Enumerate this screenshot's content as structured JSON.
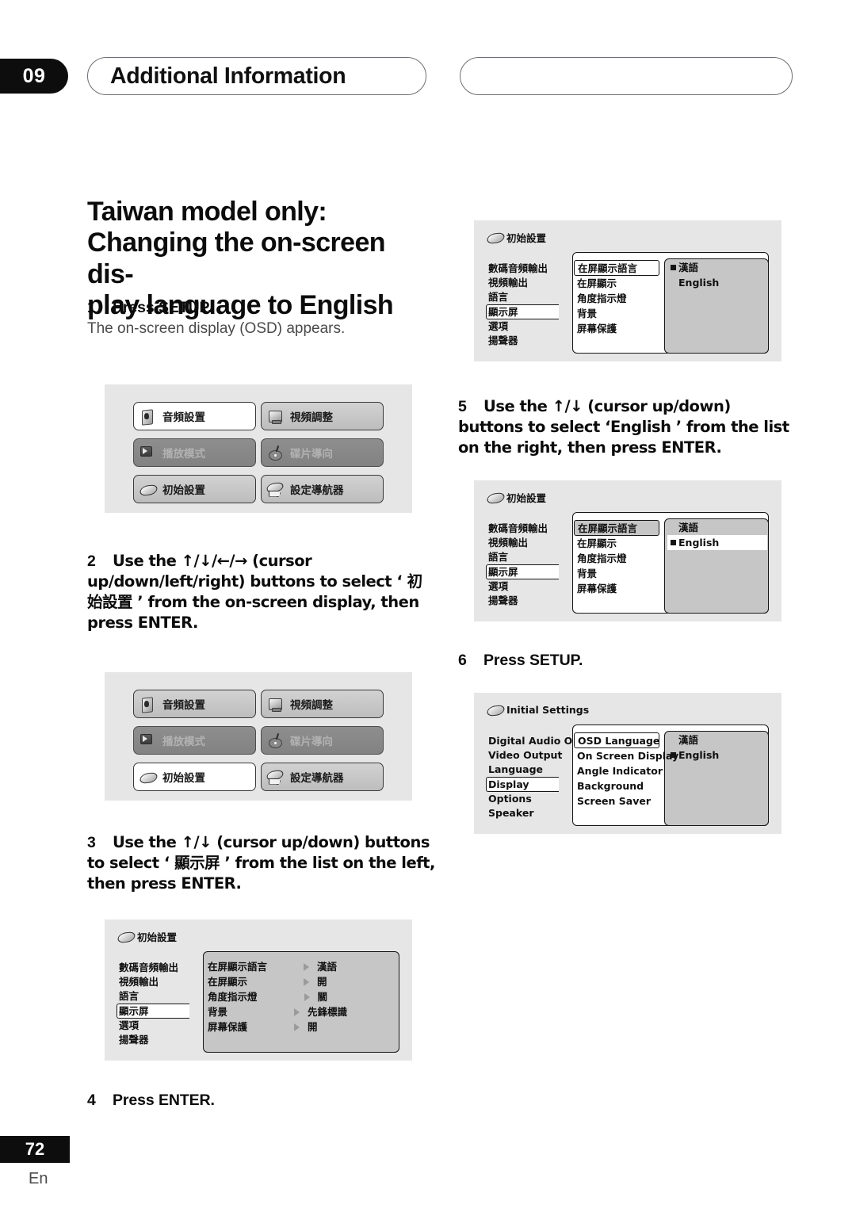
{
  "header": {
    "chapter_number": "09",
    "chapter_title": "Additional Information",
    "right_pill_title": ""
  },
  "section": {
    "title": "Taiwan model only: Changing the on-screen display language to English"
  },
  "steps": {
    "step1": {
      "num": "1",
      "text": "Press SETUP.",
      "sub": "The on-screen display (OSD) appears."
    },
    "step2": {
      "num": "2",
      "text": "Use the ↑/↓/←/→ (cursor up/down/left/right) buttons to select ‘ 初始設置 ’ from the on-screen display, then press ENTER."
    },
    "step3": {
      "num": "3",
      "text": "Use the ↑/↓ (cursor up/down) buttons to select ‘ 顯示屏 ’ from the list on the left, then press ENTER."
    },
    "step4": {
      "num": "4",
      "text": "Press ENTER."
    },
    "step5": {
      "num": "5",
      "text": "Use the ↑/↓ (cursor up/down) buttons to select ‘English ’ from the list on the right, then press ENTER."
    },
    "step6": {
      "num": "6",
      "text": "Press SETUP."
    }
  },
  "osd_home": {
    "buttons": [
      {
        "label": "音頻設置",
        "icon": "audio-settings-icon",
        "state": "normal"
      },
      {
        "label": "視頻調整",
        "icon": "video-adjust-icon",
        "state": "normal"
      },
      {
        "label": "播放模式",
        "icon": "play-mode-icon",
        "state": "disabled"
      },
      {
        "label": "碟片導向",
        "icon": "disc-navigator-icon",
        "state": "disabled"
      },
      {
        "label": "初始設置",
        "icon": "initial-settings-icon",
        "state": "normal"
      },
      {
        "label": "設定導航器",
        "icon": "setup-navigator-icon",
        "state": "normal"
      }
    ],
    "selected_first": "音頻設置",
    "selected_second": "初始設置"
  },
  "initial_settings_cjk": {
    "title": "初始設置",
    "categories": [
      "數碼音頻輸出",
      "視頻輸出",
      "語言",
      "顯示屏",
      "選項",
      "揚聲器"
    ],
    "selected_category": "顯示屏",
    "items": [
      "在屏顯示語言",
      "在屏顯示",
      "角度指示燈",
      "背景",
      "屏幕保護"
    ],
    "values": [
      "漢語",
      "開",
      "關",
      "先鋒標識",
      "開"
    ],
    "selected_item": "在屏顯示語言",
    "language_options": [
      "漢語",
      "English"
    ]
  },
  "initial_settings_en": {
    "title": "Initial Settings",
    "categories": [
      "Digital Audio Out",
      "Video Output",
      "Language",
      "Display",
      "Options",
      "Speaker"
    ],
    "selected_category": "Display",
    "items": [
      "OSD Language",
      "On Screen Display",
      "Angle Indicator",
      "Background",
      "Screen Saver"
    ],
    "selected_item": "OSD Language",
    "language_options": [
      "漢語",
      "English"
    ],
    "selected_language": "English"
  },
  "footer": {
    "page_number": "72",
    "language_code": "En"
  }
}
